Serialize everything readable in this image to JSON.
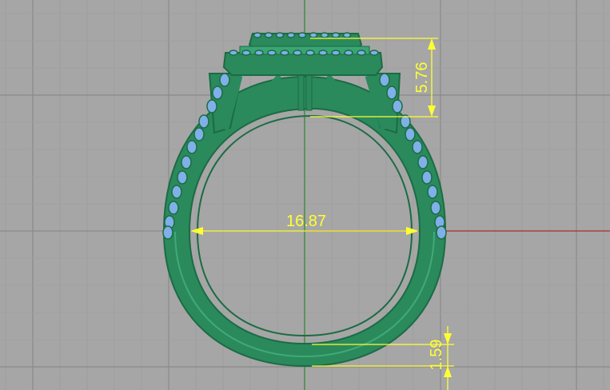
{
  "viewport": {
    "background": "#a6a6a6",
    "grid_minor_color": "#9e9e9e",
    "grid_major_color": "#8a8a8a",
    "y_axis_color": "#2e8b2e",
    "x_axis_color": "#b03030"
  },
  "model": {
    "metal_color": "#2a8a5c",
    "metal_dark": "#1c6b44",
    "metal_light": "#4bb783",
    "stone_color": "#7fb0e8"
  },
  "dimensions": {
    "color": "#ffff33",
    "inner_diameter": "16.87",
    "head_height": "5.76",
    "band_thickness": "1.59"
  }
}
